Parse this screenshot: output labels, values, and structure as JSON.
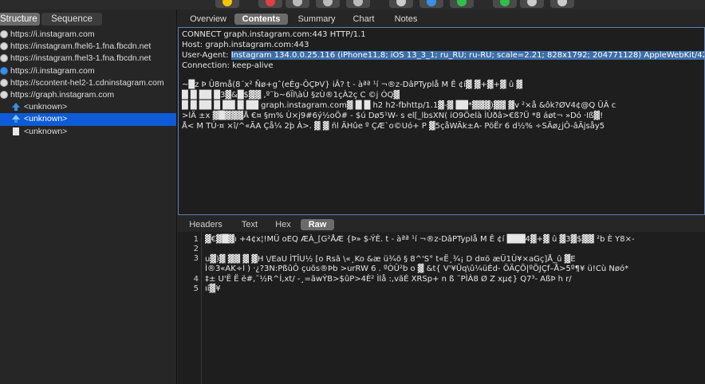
{
  "left_panel": {
    "segments": {
      "structure": "Structure",
      "sequence": "Sequence"
    },
    "rows": [
      {
        "text": "https://i.instagram.com",
        "icon": "globe-icon"
      },
      {
        "text": "https://instagram.fhel6-1.fna.fbcdn.net",
        "icon": "globe-icon"
      },
      {
        "text": "https://instagram.fhel3-1.fna.fbcdn.net",
        "icon": "globe-icon"
      },
      {
        "text": "https://i.instagram.com",
        "icon": "lightning-icon"
      },
      {
        "text": "https://scontent-hel2-1.cdninstagram.com",
        "icon": "globe-icon"
      },
      {
        "text": "https://graph.instagram.com",
        "icon": "globe-icon"
      },
      {
        "text": "<unknown>",
        "icon": "upload-arrow-icon"
      },
      {
        "text": "<unknown>",
        "icon": "upload-arrow-icon",
        "selected": true
      },
      {
        "text": "<unknown>",
        "icon": "document-icon"
      }
    ]
  },
  "tabs": [
    "Overview",
    "Contents",
    "Summary",
    "Chart",
    "Notes"
  ],
  "active_tab": "Contents",
  "contents": {
    "line1": "CONNECT graph.instagram.com:443 HTTP/1.1",
    "line2": "Host: graph.instagram.com:443",
    "line3_label": "User-Agent: ",
    "line3_value": "Instagram 134.0.0.25.116 (iPhone11,8; iOS 13_3_1; ru_RU; ru-RU; scale=2.21; 828x1792; 204771128) AppleWebKit/420+",
    "line4": "Connection: keep-alive",
    "bin1": "  ~█z  Þ Û8må(8´x²   Ñø+gˆ(eÈg-ÔÇÞV}   iÂ? t  -  àªª  ¹í ¬®z-DâPTyplå M   Ê   ¢í▓     ▓+▓+▓   û ▓",
    "bin2": "█ █ ██ █3▓&█$▓▓ ,º˜b~6Ïl\\àÙ       §zÙ®1çÀ2ç C   ©j   ÓQ▓",
    "bin3": "█ █ ██ █ ██ █ ██ graph.instagram.com▓ █ █   h2 h2-fbhttp/1.1▓-▓  ██*▓▓▓)▓▓ ▓v    ²×å      &ôk?ØV4¢@Q          ÜÂ c",
    "bin4": ">lÄ   ±x ▓█▓▓▓Å   €¤ §m%   Ù×j9#6ý½oÖ#   -   $ú   Dø5¹W-      s    el[_lbsXN(   iO9Öelà   ÌÙðâ>€ß?Ü   *8  áøt¬   »Dó ·Iß▓!",
    "bin5": "Å< M TÚ·¤    ×î/^«ÃA   Çå¼   2þ        À>.   ▓   ▓ ñl   ÄHûe   º ÇÆ`o©Uó+ P    ▓5çåWÄk±A-   PöËr   6         d½% ÷SÄø¿jÔ-âÄjsåy5"
  },
  "subtabs": [
    "Headers",
    "Text",
    "Hex",
    "Raw"
  ],
  "active_subtab": "Raw",
  "raw": {
    "line_numbers": [
      "1",
      "2",
      "3",
      "4",
      "5"
    ],
    "l1": "  ▓€▓█▓ı  +4¢x¦!MÜ    oEQ ÆÀ_[G²ÅÆ    {Þ» $-ÝÈ. t   -   àªª    ¹í ¬®z-DâPTyplå M    Ê   ¢í ███4▓+▓ û ▓3▓$▓▓ ²b   È Y8×-",
    "l3a": "u▓)▓ ▓▓   ▓   ▓H \\/EaU ÌTÎU½    [o    Rsã  \\«¸Ko    &æ     ü¾õ §        8^'S°  t«Ë¸¾¡               D d¤ö   æÜ1Û¥×aGç]Å_û   ▓E",
    "l3b": "  Ì®3«AK÷l   ) ·¿?3N:PßûÔ çuõs®Þb   >urRW 6   .   ºÒÛ²b  o     ▓ &t{    V'¥Üq\\û¼üÉd-    ÖÄÇÕ|ºÕJÇf–Å>5º¶¥    ü!Cù Nøó*",
    "l4": "‡± U'Ë     Ë ë#,˜½R^Í,xt/    -¸=ãwÝB>$ûP>4È²         Ìlå :,vãÉ XRSp+ n     ß    ˜PÌÀ8    Ø    Z    xµ¢} Q7³- AßÞ h r/",
    "l5": "ıí▓¥"
  }
}
